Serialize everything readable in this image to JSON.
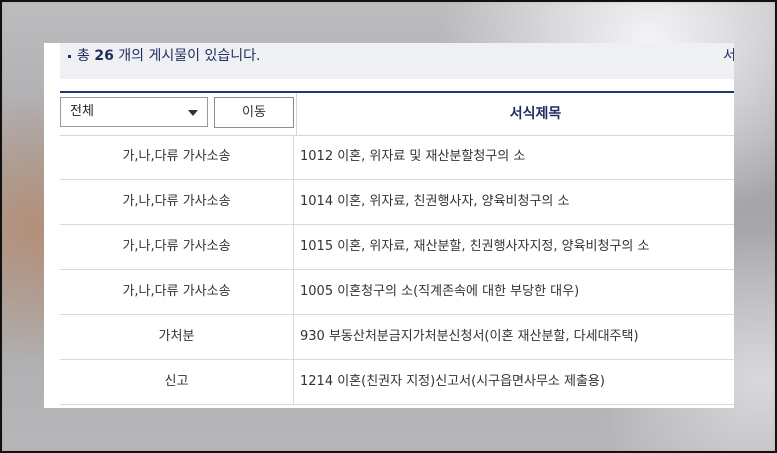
{
  "info": {
    "prefix": "총 ",
    "count": "26",
    "suffix": " 개의 게시물이 있습니다.",
    "right_fragment": "서"
  },
  "filter": {
    "selected": "전체",
    "move_label": "이동"
  },
  "table": {
    "title_header": "서식제목",
    "rows": [
      {
        "category": "가,나,다류 가사소송",
        "title": "1012 이혼, 위자료 및 재산분할청구의 소"
      },
      {
        "category": "가,나,다류 가사소송",
        "title": "1014 이혼, 위자료, 친권행사자, 양육비청구의 소"
      },
      {
        "category": "가,나,다류 가사소송",
        "title": "1015 이혼, 위자료, 재산분할, 친권행사자지정, 양육비청구의 소"
      },
      {
        "category": "가,나,다류 가사소송",
        "title": "1005 이혼청구의 소(직계존속에 대한 부당한 대우)"
      },
      {
        "category": "가처분",
        "title": "930 부동산처분금지가처분신청서(이혼 재산분할, 다세대주택)"
      },
      {
        "category": "신고",
        "title": "1214 이혼(친권자 지정)신고서(시구읍면사무소 제출용)"
      }
    ]
  }
}
